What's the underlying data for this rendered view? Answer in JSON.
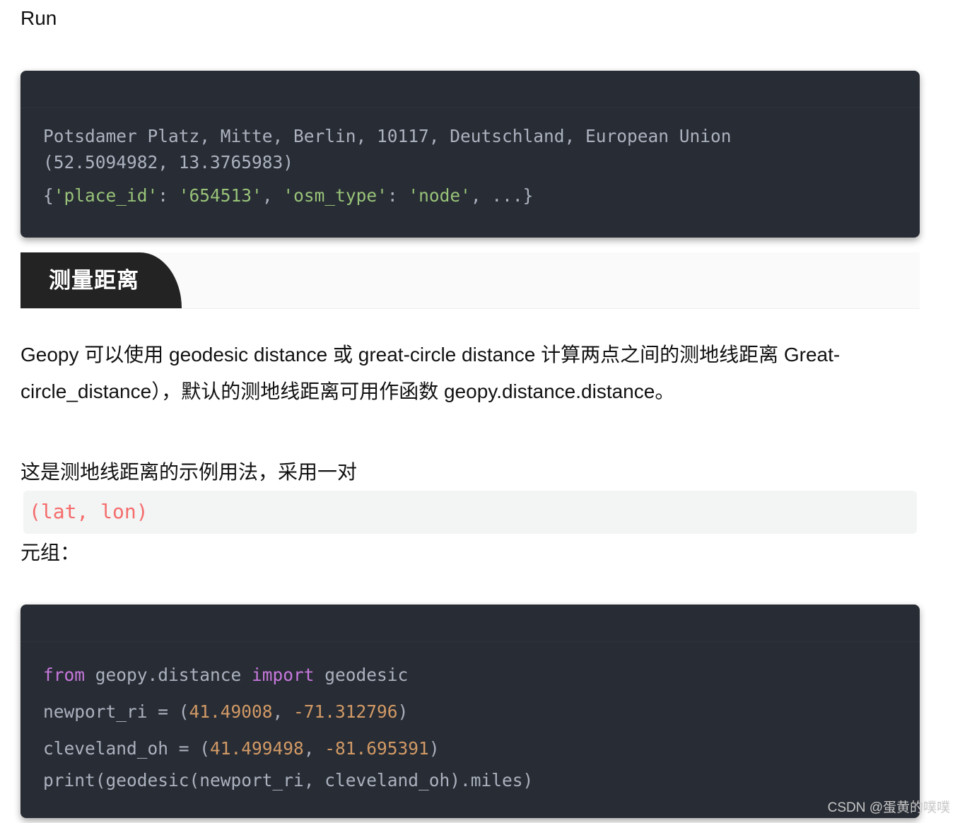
{
  "run_label": "Run",
  "output_block": {
    "lines": [
      [
        {
          "t": "Potsdamer Platz, Mitte, Berlin, 10117, Deutschland, European Union",
          "c": "plain"
        }
      ],
      [
        {
          "t": "(52.5094982, 13.3765983)",
          "c": "plain"
        }
      ],
      [
        {
          "t": "{",
          "c": "plain"
        },
        {
          "t": "'place_id'",
          "c": "str"
        },
        {
          "t": ": ",
          "c": "plain"
        },
        {
          "t": "'654513'",
          "c": "str"
        },
        {
          "t": ", ",
          "c": "plain"
        },
        {
          "t": "'osm_type'",
          "c": "str"
        },
        {
          "t": ": ",
          "c": "plain"
        },
        {
          "t": "'node'",
          "c": "str"
        },
        {
          "t": ", ...}",
          "c": "plain"
        }
      ]
    ]
  },
  "section": {
    "heading": "测量距离"
  },
  "paragraphs": {
    "intro": "Geopy 可以使用 geodesic distance 或 great-circle distance 计算两点之间的测地线距离 Great-circle_distance），默认的测地线距离可用作函数 geopy.distance.distance。",
    "example_lead": "这是测地线距离的示例用法，采用一对",
    "inline_code": "(lat, lon)",
    "example_tail": "元组："
  },
  "code_block": {
    "lines": [
      [
        {
          "t": "from",
          "c": "kw"
        },
        {
          "t": " geopy.distance ",
          "c": "plain"
        },
        {
          "t": "import",
          "c": "kw"
        },
        {
          "t": " geodesic",
          "c": "plain"
        }
      ],
      [
        {
          "t": "newport_ri = (",
          "c": "plain"
        },
        {
          "t": "41.49008",
          "c": "num"
        },
        {
          "t": ", ",
          "c": "plain"
        },
        {
          "t": "-71.312796",
          "c": "num"
        },
        {
          "t": ")",
          "c": "plain"
        }
      ],
      [
        {
          "t": "cleveland_oh = (",
          "c": "plain"
        },
        {
          "t": "41.499498",
          "c": "num"
        },
        {
          "t": ", ",
          "c": "plain"
        },
        {
          "t": "-81.695391",
          "c": "num"
        },
        {
          "t": ")",
          "c": "plain"
        }
      ],
      [
        {
          "t": "print(geodesic(newport_ri, cleveland_oh).miles)",
          "c": "plain"
        }
      ]
    ]
  },
  "watermark": "CSDN @蛋黄的噗噗",
  "colors": {
    "code_bg": "#282c34",
    "string": "#98c379",
    "keyword": "#c678dd",
    "number": "#d19a66",
    "plain": "#abb2bf",
    "inline_code": "#f56c6c"
  }
}
